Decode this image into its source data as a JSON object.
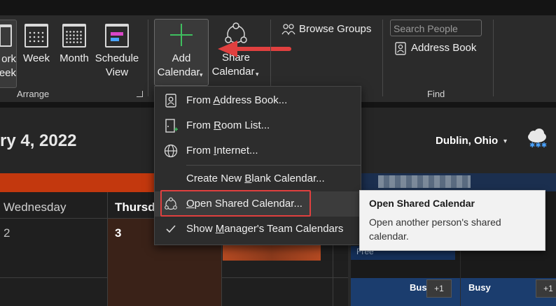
{
  "ribbon": {
    "work_week_label_line1": "ork",
    "work_week_label_line2": "eek",
    "week_label": "Week",
    "month_label": "Month",
    "schedule_view_line1": "Schedule",
    "schedule_view_line2": "View",
    "arrange_group": "Arrange",
    "add_calendar_line1": "Add",
    "add_calendar_line2": "Calendar",
    "share_calendar_line1": "Share",
    "share_calendar_line2": "Calendar",
    "browse_groups": "Browse Groups",
    "search_people_placeholder": "Search People",
    "address_book": "Address Book",
    "find_group": "Find"
  },
  "header": {
    "date": "ry 4, 2022",
    "location": "Dublin, Ohio"
  },
  "calendar": {
    "wednesday": "Wednesday",
    "wednesday_num": "2",
    "thursday": "Thursd",
    "thursday_num": "3",
    "free": "Free",
    "busy1": "Bus",
    "busy2": "Busy",
    "plus1a": "+1",
    "plus1b": "+1"
  },
  "menu": {
    "items": [
      {
        "prefix": "From ",
        "underline": "A",
        "suffix": "ddress Book...",
        "icon": "contact-card-icon"
      },
      {
        "prefix": "From ",
        "underline": "R",
        "suffix": "oom List...",
        "icon": "room-door-icon"
      },
      {
        "prefix": "From ",
        "underline": "I",
        "suffix": "nternet...",
        "icon": "globe-icon"
      },
      {
        "prefix": "Create New ",
        "underline": "B",
        "suffix": "lank Calendar...",
        "icon": ""
      },
      {
        "prefix": "",
        "underline": "O",
        "suffix": "pen Shared Calendar...",
        "icon": "share-nodes-icon"
      },
      {
        "prefix": "Show ",
        "underline": "M",
        "suffix": "anager's Team Calendars",
        "icon": "checkmark-icon"
      }
    ]
  },
  "tooltip": {
    "title": "Open Shared Calendar",
    "line1": "Open another person's shared",
    "line2": "calendar."
  },
  "colors": {
    "accent_green": "#3fbf5f",
    "annotation_red": "#e0403f",
    "orange_strip": "#c3380e",
    "event_blue": "#1b3d6e"
  }
}
